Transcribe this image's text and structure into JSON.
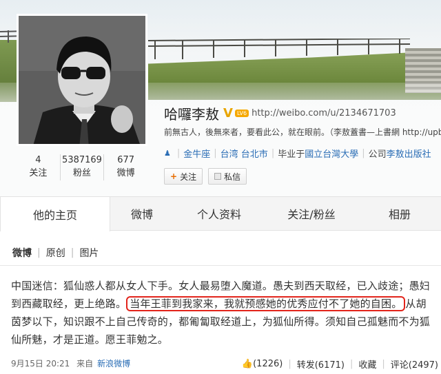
{
  "profile": {
    "name": "哈囉李敖",
    "verified": "V",
    "level": "LV6",
    "url": "http://weibo.com/u/2134671703",
    "bio": "前無古人，後無來者，要看此公，就在眼前。（李敖蓋書—上書網 http://upbo",
    "sign": "金牛座",
    "location": "台湾 台北市",
    "education_prefix": "毕业于",
    "school": "國立台灣大學",
    "company_prefix": "公司",
    "company": "李敖出版社"
  },
  "stats": [
    {
      "num": "4",
      "label": "关注"
    },
    {
      "num": "5387169",
      "label": "粉丝"
    },
    {
      "num": "677",
      "label": "微博"
    }
  ],
  "buttons": {
    "follow": "关注",
    "message": "私信"
  },
  "tabs": [
    {
      "label": "他的主页"
    },
    {
      "label": "微博"
    },
    {
      "label": "个人资料"
    },
    {
      "label": "关注/粉丝"
    },
    {
      "label": "相册"
    }
  ],
  "filter": {
    "current": "微博",
    "original": "原创",
    "pictures": "图片"
  },
  "post": {
    "text_before": "中国迷信：狐仙惑人都从女人下手。女人最易堕入魔道。愚夫到西天取经，已入歧途；愚妇到西藏取经，更上绝路。",
    "text_highlight": "当年王菲到我家来，我就预感她的优秀应付不了她的自困。",
    "text_after": "从胡茵梦以下，知识跟不上自己传奇的，都匍匐取经道上，为狐仙所得。须知自己孤魅而不为狐仙所魅，才是正道。愿王菲勉之。",
    "time": "9月15日 20:21",
    "source_prefix": "来自",
    "source": "新浪微博",
    "like": "(1226)",
    "repost": "转发(6171)",
    "favorite": "收藏",
    "comment": "评论(2497)"
  },
  "colors": {
    "link": "#2a6db5",
    "highlight_border": "#e2231a",
    "verified": "#e8a500"
  }
}
